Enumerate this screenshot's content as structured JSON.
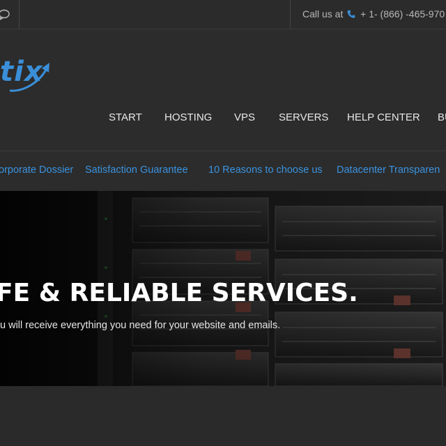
{
  "topbar": {
    "call_prefix": "Call us at",
    "phone_number": "+ 1- (866) -465-970",
    "icons": {
      "chat": "chat-bubble-icon",
      "phone": "phone-icon"
    }
  },
  "header": {
    "logo_text": "tix",
    "nav": [
      {
        "label": "START"
      },
      {
        "label": "HOSTING"
      },
      {
        "label": "VPS"
      },
      {
        "label": "SERVERS"
      },
      {
        "label": "HELP CENTER"
      },
      {
        "label": "BU"
      }
    ]
  },
  "subnav": {
    "items": [
      {
        "label": "orporate Dossier"
      },
      {
        "label": "Satisfaction Guarantee"
      },
      {
        "label": "10 Reasons to choose us"
      },
      {
        "label": "Datacenter Transparen"
      }
    ]
  },
  "hero": {
    "headline": "FE & RELIABLE SERVICES.",
    "tagline": "u will receive everything you need for your website and emails."
  },
  "colors": {
    "accent": "#3a93e0",
    "phone_icon": "#3a8fd8",
    "background": "#2a2a2a",
    "hero_background": "#121212"
  }
}
